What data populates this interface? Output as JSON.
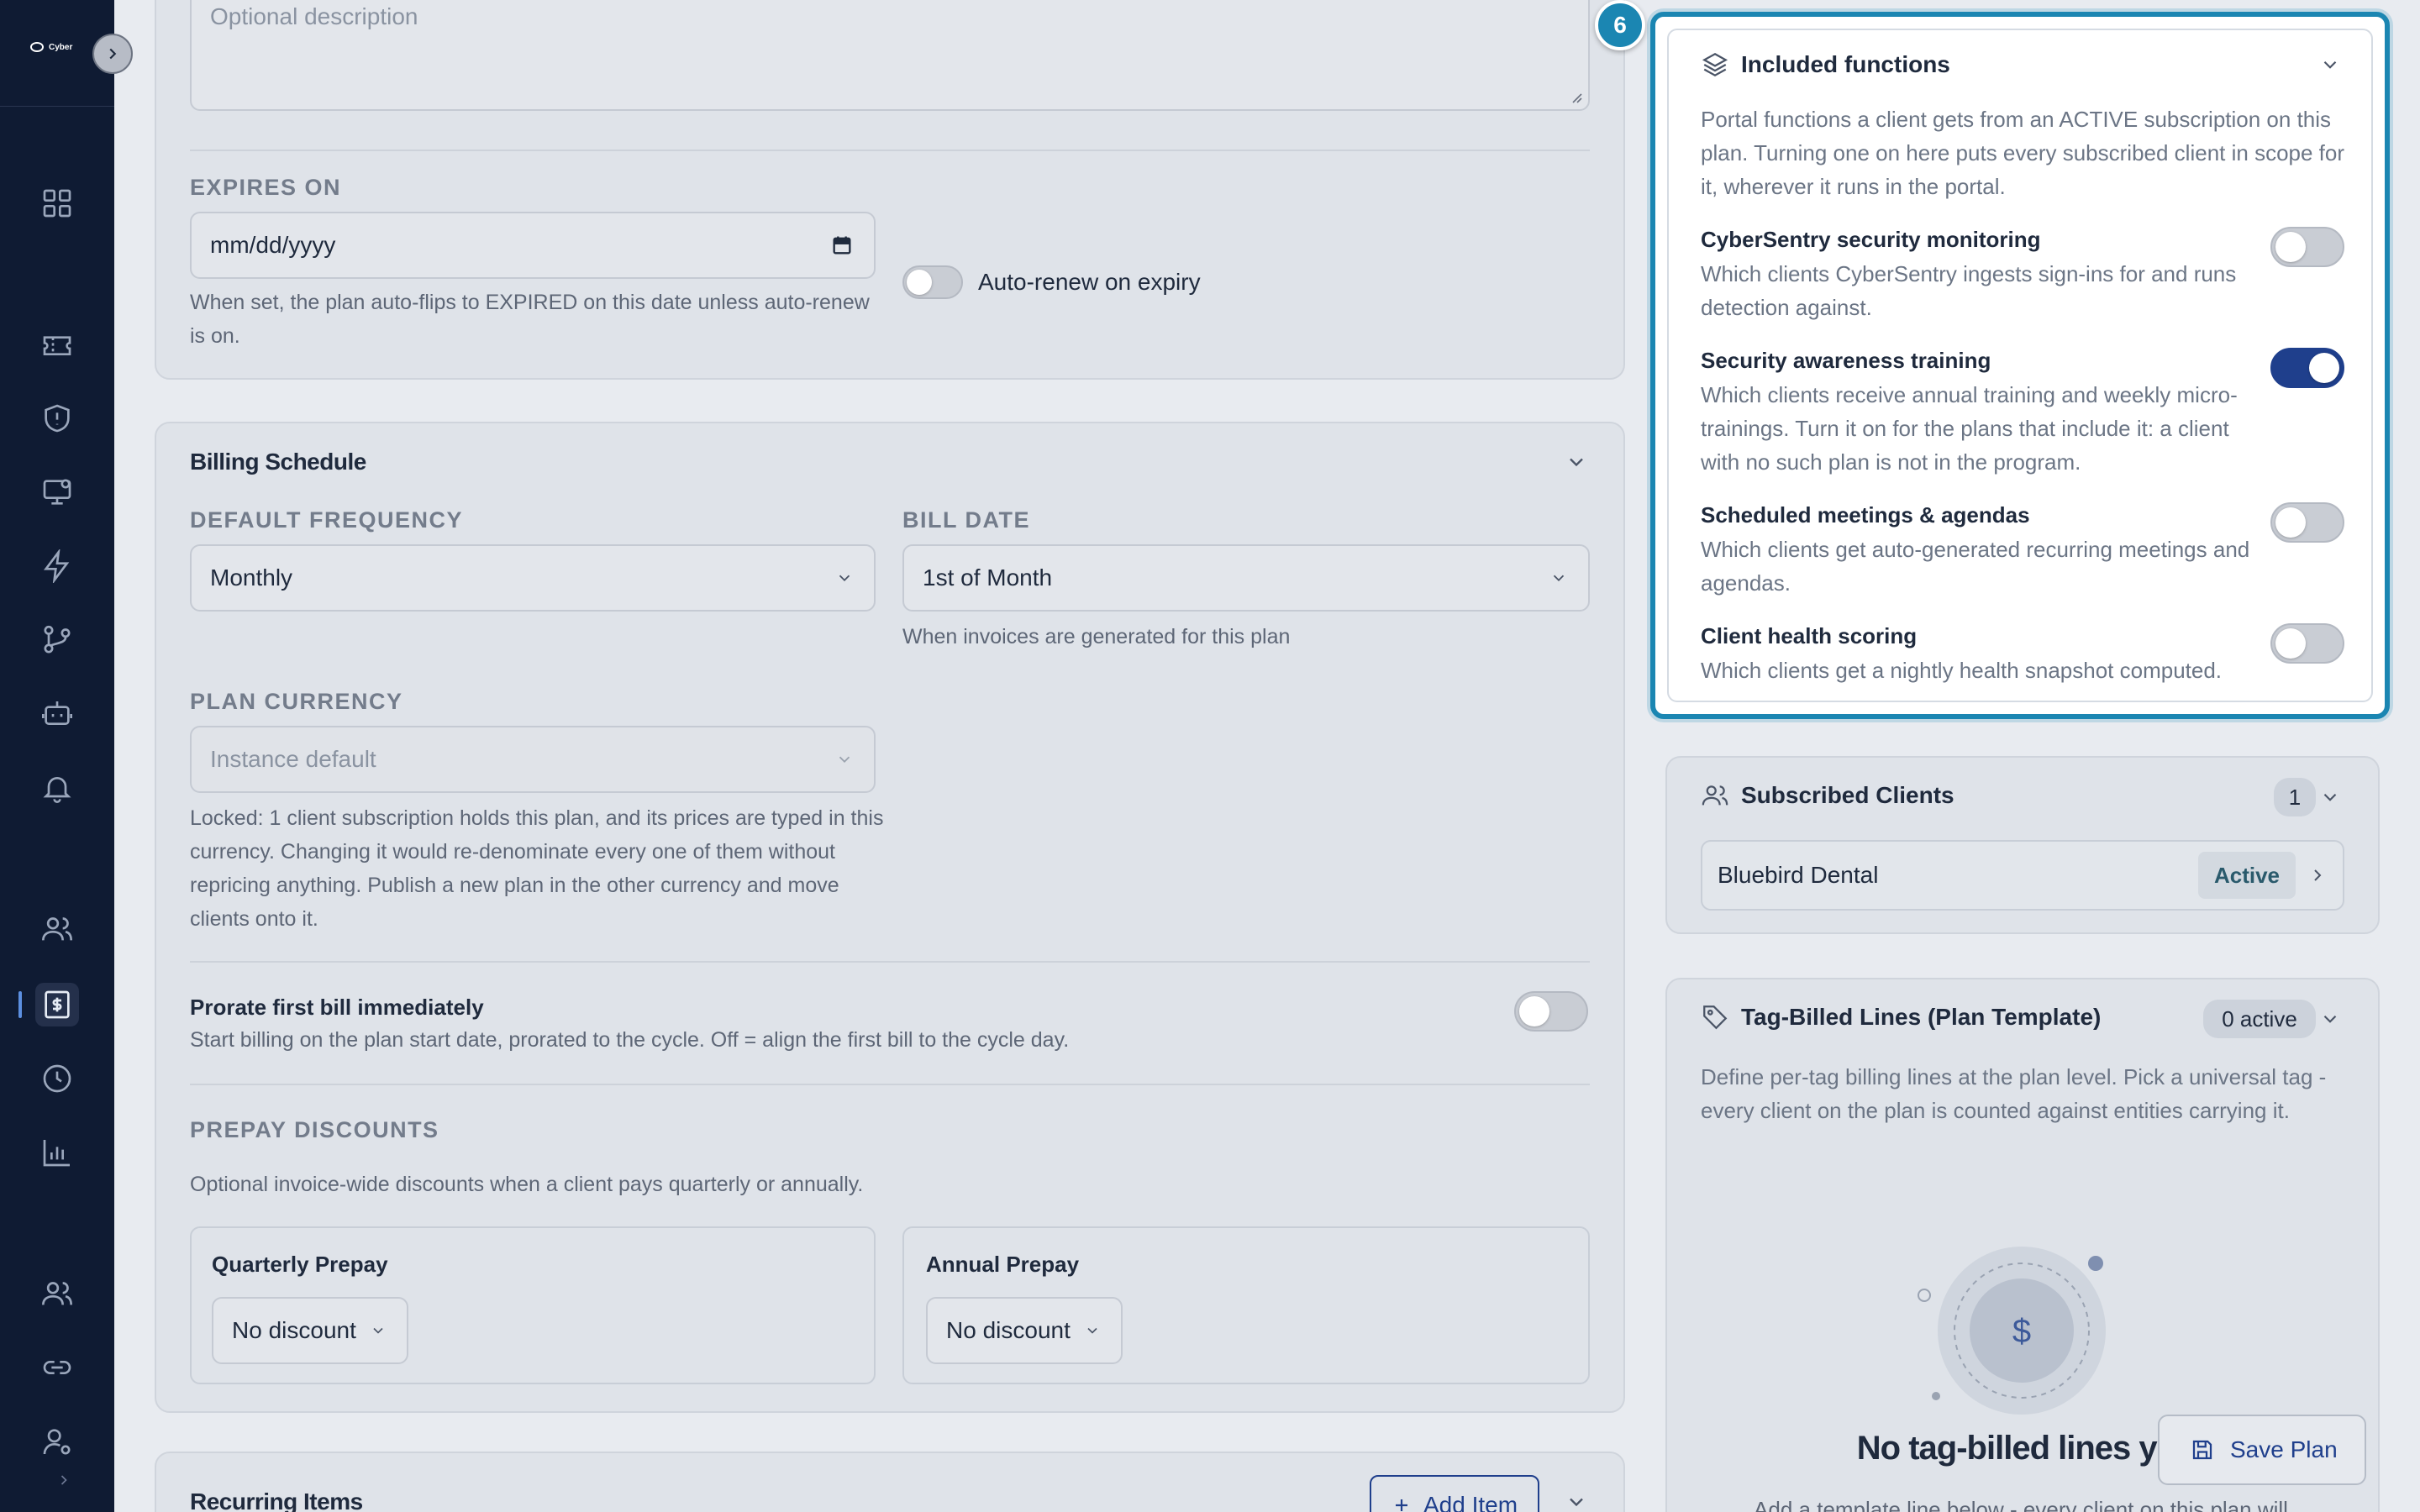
{
  "sidebar": {
    "logo_text": "Cyber",
    "nav_icons": [
      "grid-icon",
      "ticket-icon",
      "shield-icon",
      "monitor-icon",
      "bolt-icon",
      "branch-icon",
      "robot-icon",
      "bell-icon",
      "users-icon",
      "billing-icon",
      "clock-icon",
      "chart-icon",
      "people-icon",
      "link-icon",
      "user-settings-icon"
    ],
    "active_item": "billing-icon"
  },
  "plan_details": {
    "description_placeholder": "Optional description",
    "expires_label": "EXPIRES ON",
    "expires_placeholder": "mm/dd/yyyy",
    "expires_help": "When set, the plan auto-flips to EXPIRED on this date unless auto-renew is on.",
    "auto_renew_label": "Auto-renew on expiry",
    "auto_renew_on": false
  },
  "billing_schedule": {
    "title": "Billing Schedule",
    "default_frequency_label": "DEFAULT FREQUENCY",
    "default_frequency_value": "Monthly",
    "bill_date_label": "BILL DATE",
    "bill_date_value": "1st of Month",
    "bill_date_help": "When invoices are generated for this plan",
    "plan_currency_label": "PLAN CURRENCY",
    "plan_currency_value": "Instance default",
    "plan_currency_help": "Locked: 1 client subscription holds this plan, and its prices are typed in this currency. Changing it would re-denominate every one of them without repricing anything. Publish a new plan in the other currency and move clients onto it.",
    "prorate_title": "Prorate first bill immediately",
    "prorate_help": "Start billing on the plan start date, prorated to the cycle. Off = align the first bill to the cycle day.",
    "prorate_on": false,
    "prepay_label": "PREPAY DISCOUNTS",
    "prepay_help": "Optional invoice-wide discounts when a client pays quarterly or annually.",
    "quarterly_title": "Quarterly Prepay",
    "quarterly_value": "No discount",
    "annual_title": "Annual Prepay",
    "annual_value": "No discount"
  },
  "recurring_items": {
    "title": "Recurring Items",
    "add_label": "Add Item"
  },
  "tour": {
    "step": "6"
  },
  "included_functions": {
    "title": "Included functions",
    "description": "Portal functions a client gets from an ACTIVE subscription on this plan. Turning one on here puts every subscribed client in scope for it, wherever it runs in the portal.",
    "items": [
      {
        "name": "CyberSentry security monitoring",
        "desc": "Which clients CyberSentry ingests sign-ins for and runs detection against.",
        "on": false
      },
      {
        "name": "Security awareness training",
        "desc": "Which clients receive annual training and weekly micro-trainings. Turn it on for the plans that include it: a client with no such plan is not in the program.",
        "on": true
      },
      {
        "name": "Scheduled meetings & agendas",
        "desc": "Which clients get auto-generated recurring meetings and agendas.",
        "on": false
      },
      {
        "name": "Client health scoring",
        "desc": "Which clients get a nightly health snapshot computed.",
        "on": false
      }
    ]
  },
  "subscribed_clients": {
    "title": "Subscribed Clients",
    "count": "1",
    "client_name": "Bluebird Dental",
    "client_status": "Active"
  },
  "tag_billed": {
    "title": "Tag-Billed Lines (Plan Template)",
    "count_badge": "0 active",
    "description": "Define per-tag billing lines at the plan level. Pick a universal tag - every client on the plan is counted against entities carrying it.",
    "empty_title": "No tag-billed lines yet",
    "empty_sub": "Add a template line below - every client on this plan will",
    "currency_symbol": "$"
  },
  "save_label": "Save Plan",
  "colors": {
    "sidebar_bg": "#0f1b33",
    "accent": "#1f3f8c",
    "highlight": "#1b86b2"
  }
}
